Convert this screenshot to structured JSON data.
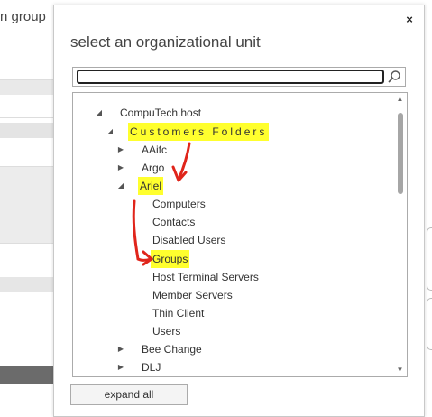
{
  "background": {
    "title_fragment": "n group",
    "band_colors": [
      "#e9e9e9",
      "#e4e4e4",
      "#e6e6e6",
      "#e4e4e4",
      "#6b6b6b"
    ]
  },
  "dialog": {
    "title": "select an organizational unit",
    "close_symbol": "×",
    "search": {
      "value": "",
      "placeholder": ""
    },
    "expand_all_label": "expand all",
    "highlight_color": "#ffff2e",
    "annotation_color": "#e0251b"
  },
  "tree": {
    "nodes": [
      {
        "label": "CompuTech.host",
        "state": "expanded",
        "level": 0
      },
      {
        "label": "Customers Folders",
        "state": "expanded",
        "level": 1,
        "highlight": true
      },
      {
        "label": "AAifc",
        "state": "collapsed",
        "level": 2
      },
      {
        "label": "Argo",
        "state": "collapsed",
        "level": 2
      },
      {
        "label": "Ariel",
        "state": "expanded",
        "level": 2,
        "highlight": true
      },
      {
        "label": "Computers",
        "state": "leaf",
        "level": 3
      },
      {
        "label": "Contacts",
        "state": "leaf",
        "level": 3
      },
      {
        "label": "Disabled Users",
        "state": "leaf",
        "level": 3
      },
      {
        "label": "Groups",
        "state": "leaf",
        "level": 3,
        "highlight": true
      },
      {
        "label": "Host Terminal Servers",
        "state": "leaf",
        "level": 3
      },
      {
        "label": "Member Servers",
        "state": "leaf",
        "level": 3
      },
      {
        "label": "Thin Client",
        "state": "leaf",
        "level": 3
      },
      {
        "label": "Users",
        "state": "leaf",
        "level": 3
      },
      {
        "label": "Bee Change",
        "state": "collapsed",
        "level": 2
      },
      {
        "label": "DLJ",
        "state": "collapsed",
        "level": 2
      }
    ]
  }
}
